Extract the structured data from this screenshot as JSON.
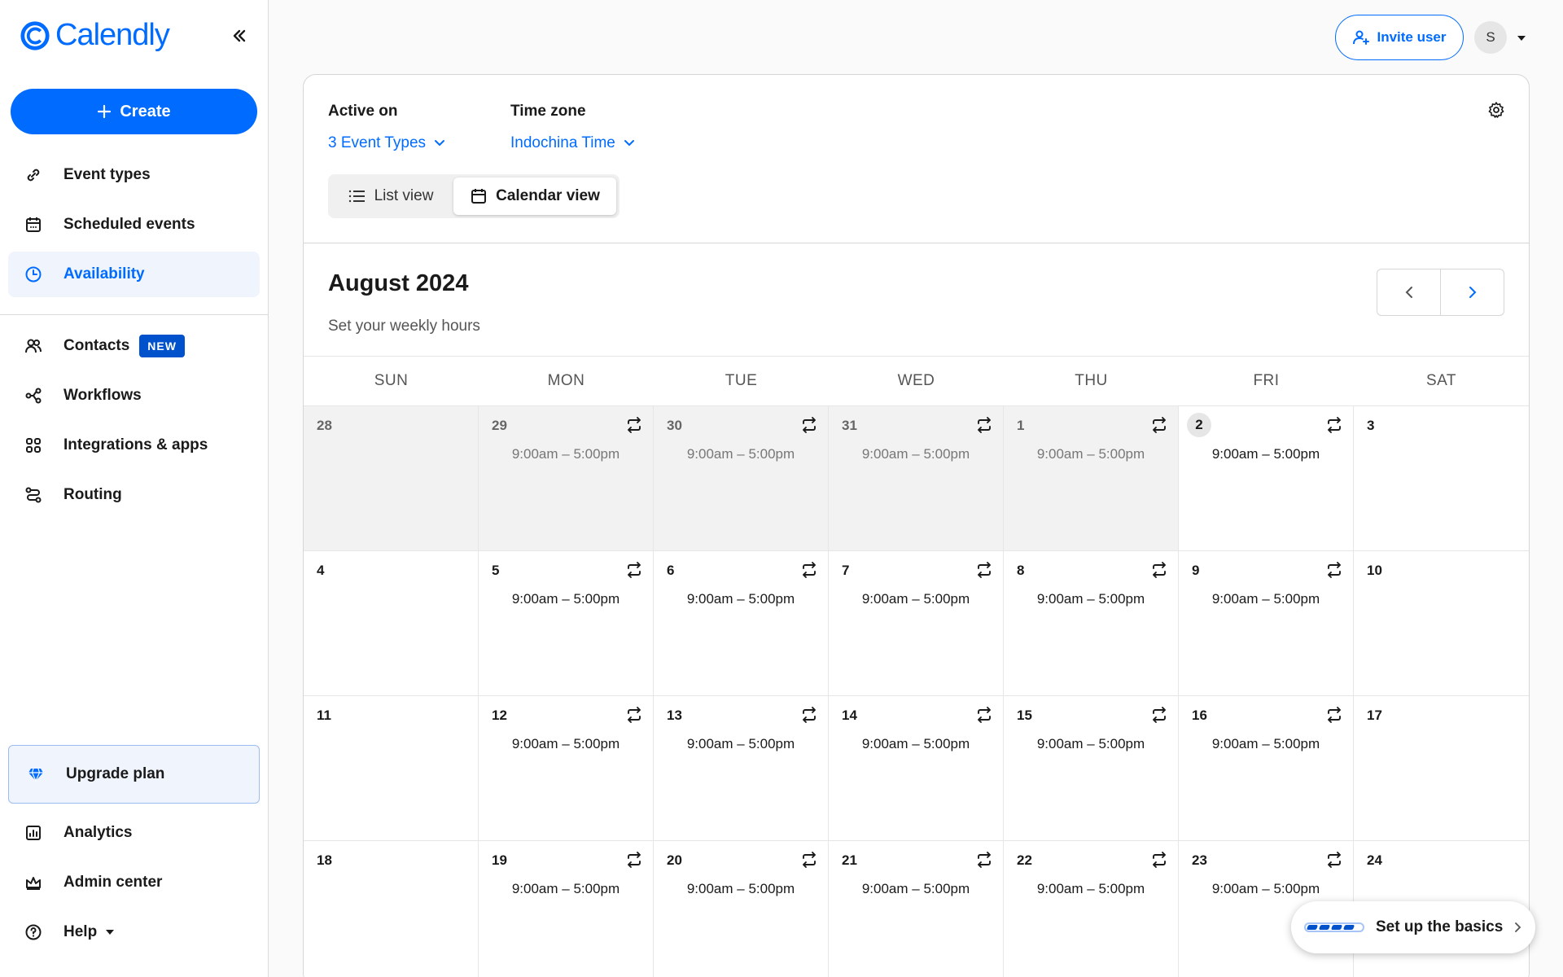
{
  "app": {
    "logo_text": "Calendly",
    "brand_color": "#006bff"
  },
  "sidebar": {
    "create_label": "Create",
    "items": [
      {
        "label": "Event types",
        "icon": "link-icon"
      },
      {
        "label": "Scheduled events",
        "icon": "calendar-icon"
      },
      {
        "label": "Availability",
        "icon": "clock-icon",
        "active": true
      },
      {
        "label": "Contacts",
        "icon": "people-icon",
        "badge": "NEW"
      },
      {
        "label": "Workflows",
        "icon": "workflow-icon"
      },
      {
        "label": "Integrations & apps",
        "icon": "grid-icon"
      },
      {
        "label": "Routing",
        "icon": "routing-icon"
      }
    ],
    "upgrade_label": "Upgrade plan",
    "bottom_items": [
      {
        "label": "Analytics",
        "icon": "chart-icon"
      },
      {
        "label": "Admin center",
        "icon": "crown-icon"
      },
      {
        "label": "Help",
        "icon": "help-icon"
      }
    ]
  },
  "topbar": {
    "invite_label": "Invite user",
    "avatar_initial": "S"
  },
  "filters": {
    "active_on_label": "Active on",
    "active_on_value": "3 Event Types",
    "timezone_label": "Time zone",
    "timezone_value": "Indochina Time"
  },
  "view_toggle": {
    "list_label": "List view",
    "calendar_label": "Calendar view",
    "selected": "calendar"
  },
  "calendar": {
    "month_title": "August 2024",
    "subtitle": "Set your weekly hours",
    "weekdays": [
      "SUN",
      "MON",
      "TUE",
      "WED",
      "THU",
      "FRI",
      "SAT"
    ],
    "hours_text": "9:00am – 5:00pm",
    "weeks": [
      [
        {
          "day": "28",
          "past": true,
          "hours": false
        },
        {
          "day": "29",
          "past": true,
          "hours": true
        },
        {
          "day": "30",
          "past": true,
          "hours": true
        },
        {
          "day": "31",
          "past": true,
          "hours": true
        },
        {
          "day": "1",
          "past": true,
          "hours": true
        },
        {
          "day": "2",
          "today": true,
          "hours": true
        },
        {
          "day": "3",
          "hours": false
        }
      ],
      [
        {
          "day": "4",
          "hours": false
        },
        {
          "day": "5",
          "hours": true
        },
        {
          "day": "6",
          "hours": true
        },
        {
          "day": "7",
          "hours": true
        },
        {
          "day": "8",
          "hours": true
        },
        {
          "day": "9",
          "hours": true
        },
        {
          "day": "10",
          "hours": false
        }
      ],
      [
        {
          "day": "11",
          "hours": false
        },
        {
          "day": "12",
          "hours": true
        },
        {
          "day": "13",
          "hours": true
        },
        {
          "day": "14",
          "hours": true
        },
        {
          "day": "15",
          "hours": true
        },
        {
          "day": "16",
          "hours": true
        },
        {
          "day": "17",
          "hours": false
        }
      ],
      [
        {
          "day": "18",
          "hours": false
        },
        {
          "day": "19",
          "hours": true
        },
        {
          "day": "20",
          "hours": true
        },
        {
          "day": "21",
          "hours": true
        },
        {
          "day": "22",
          "hours": true
        },
        {
          "day": "23",
          "hours": true
        },
        {
          "day": "24",
          "hours": false
        }
      ]
    ]
  },
  "setup": {
    "label": "Set up the basics",
    "progress_segments_filled": 4,
    "progress_segments_total": 5
  }
}
